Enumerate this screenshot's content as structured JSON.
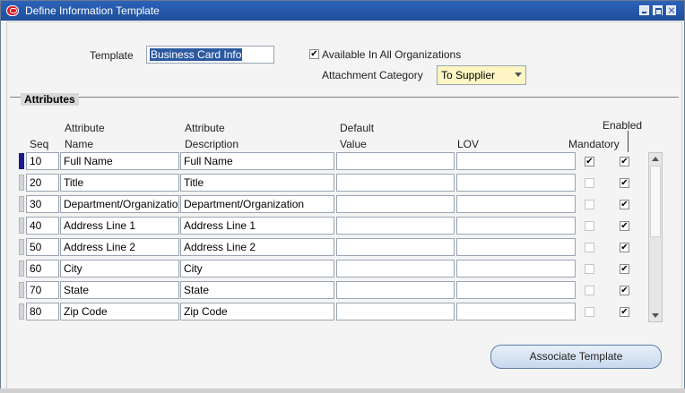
{
  "window": {
    "title": "Define Information Template"
  },
  "header": {
    "template_label": "Template",
    "template_value": "Business Card Info",
    "available_label": "Available In All Organizations",
    "available_checked": true,
    "attachment_label": "Attachment Category",
    "attachment_value": "To Supplier"
  },
  "attributes": {
    "section_title": "Attributes",
    "columns": {
      "seq": "Seq",
      "name_line1": "Attribute",
      "name_line2": "Name",
      "desc_line1": "Attribute",
      "desc_line2": "Description",
      "default_line1": "Default",
      "default_line2": "Value",
      "lov": "LOV",
      "mandatory": "Mandatory",
      "enabled": "Enabled"
    },
    "rows": [
      {
        "seq": "10",
        "name": "Full Name",
        "description": "Full Name",
        "default": "",
        "lov": "",
        "mandatory": true,
        "enabled": true
      },
      {
        "seq": "20",
        "name": "Title",
        "description": "Title",
        "default": "",
        "lov": "",
        "mandatory": false,
        "enabled": true
      },
      {
        "seq": "30",
        "name": "Department/Organization",
        "description": "Department/Organization",
        "default": "",
        "lov": "",
        "mandatory": false,
        "enabled": true
      },
      {
        "seq": "40",
        "name": "Address Line 1",
        "description": "Address Line 1",
        "default": "",
        "lov": "",
        "mandatory": false,
        "enabled": true
      },
      {
        "seq": "50",
        "name": "Address Line 2",
        "description": "Address Line 2",
        "default": "",
        "lov": "",
        "mandatory": false,
        "enabled": true
      },
      {
        "seq": "60",
        "name": "City",
        "description": "City",
        "default": "",
        "lov": "",
        "mandatory": false,
        "enabled": true
      },
      {
        "seq": "70",
        "name": "State",
        "description": "State",
        "default": "",
        "lov": "",
        "mandatory": false,
        "enabled": true
      },
      {
        "seq": "80",
        "name": "Zip Code",
        "description": "Zip Code",
        "default": "",
        "lov": "",
        "mandatory": false,
        "enabled": true
      }
    ]
  },
  "actions": {
    "associate_label": "Associate Template"
  },
  "colors": {
    "titlebar": "#2c62b8",
    "dropdown_bg": "#fdf6c3",
    "row_indicator_active": "#1a1a8c"
  }
}
